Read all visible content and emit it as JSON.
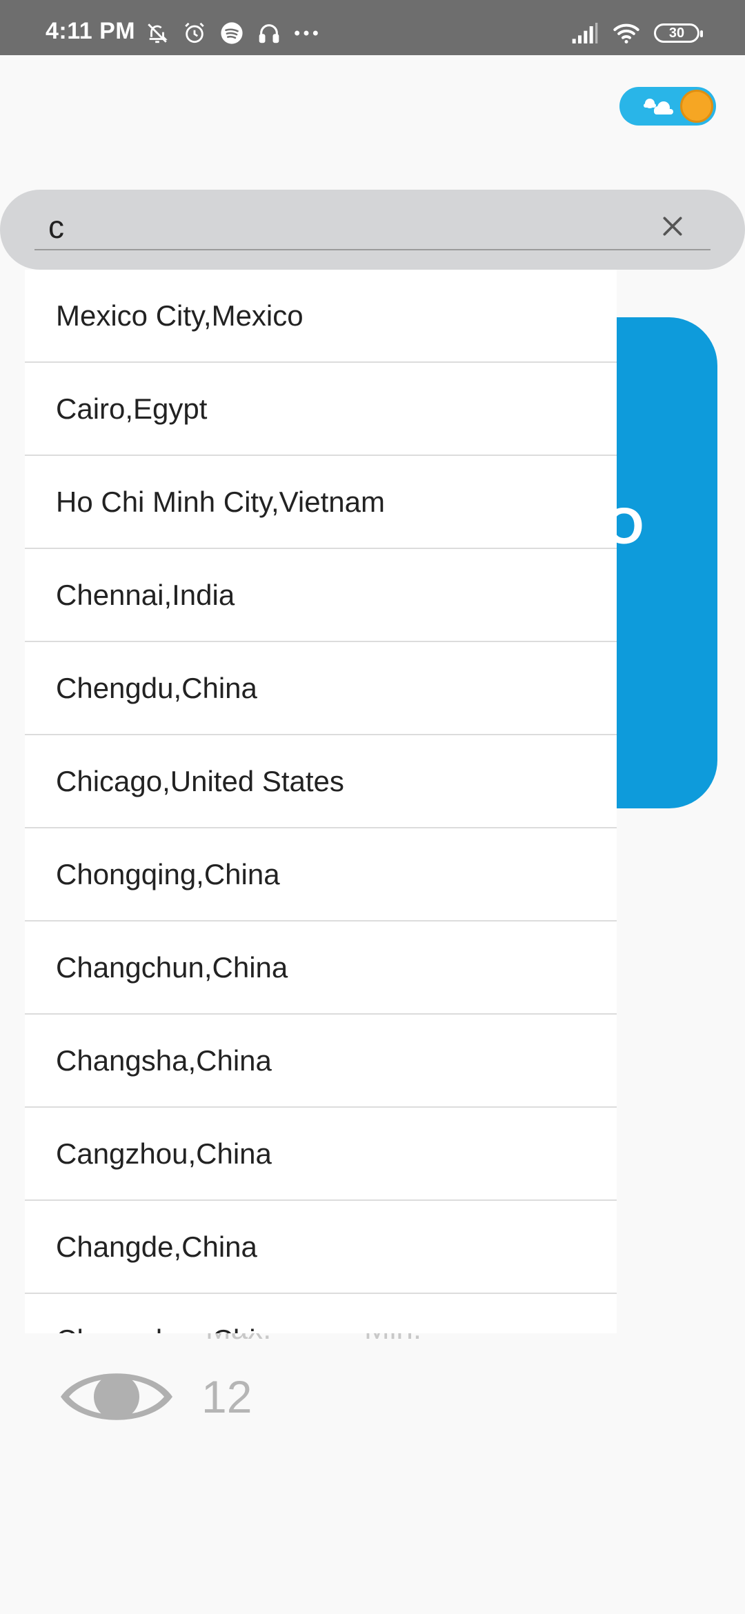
{
  "status_bar": {
    "time": "4:11 PM",
    "left_icons": [
      "mute-bell-icon",
      "alarm-icon",
      "spotify-icon",
      "headphones-icon",
      "more-dots-icon"
    ],
    "right_icons": [
      "signal-icon",
      "wifi-icon"
    ],
    "battery": "30"
  },
  "theme_toggle": {
    "state": "light",
    "track_color": "#29b5e8",
    "knob_color": "#f6a623"
  },
  "search": {
    "value": "c",
    "placeholder": "",
    "clear_icon": "close-icon"
  },
  "suggestions": [
    "Mexico City,Mexico",
    "Cairo,Egypt",
    "Ho Chi Minh City,Vietnam",
    "Chennai,India",
    "Chengdu,China",
    "Chicago,United States",
    "Chongqing,China",
    "Changchun,China",
    "Changsha,China",
    "Cangzhou,China",
    "Changde,China",
    "Changzhou,China"
  ],
  "background": {
    "card_color": "#0e9bdb",
    "card_peek_text": "O",
    "max_label": "Max.",
    "min_label": "Min.",
    "visibility_icon": "eye-icon",
    "visibility_value": "12"
  }
}
